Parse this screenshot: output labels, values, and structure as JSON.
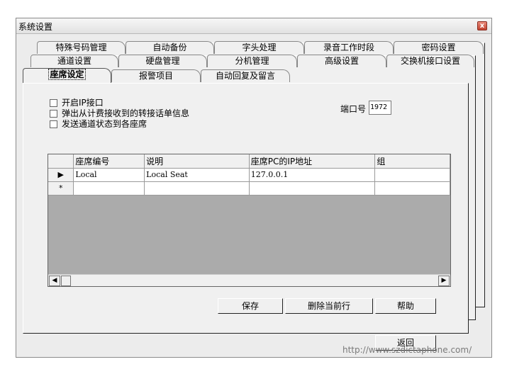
{
  "window": {
    "title": "系统设置",
    "close_glyph": "x"
  },
  "tabs": {
    "row1": [
      "特殊号码管理",
      "自动备份",
      "字头处理",
      "录音工作时段",
      "密码设置"
    ],
    "row2": [
      "通道设置",
      "硬盘管理",
      "分机管理",
      "高级设置",
      "交换机接口设置"
    ],
    "row3": [
      "座席设定",
      "报警项目",
      "自动回复及留言"
    ],
    "active": "座席设定"
  },
  "options": {
    "enable_ip": "开启IP接口",
    "popup_transfer": "弹出从计费接收到的转接话单信息",
    "send_status": "发送通道状态到各座席"
  },
  "port": {
    "label": "端口号",
    "value": "1972"
  },
  "grid": {
    "columns": [
      "座席编号",
      "说明",
      "座席PC的IP地址",
      "组"
    ],
    "rows": [
      {
        "marker": "▶",
        "seat_no": "Local",
        "desc": "Local Seat",
        "ip": "127.0.0.1",
        "group": ""
      },
      {
        "marker": "*",
        "seat_no": "",
        "desc": "",
        "ip": "",
        "group": ""
      }
    ]
  },
  "buttons": {
    "save": "保存",
    "delete_row": "删除当前行",
    "help": "帮助",
    "back": "返回"
  },
  "watermark": "http://www.szdictaphone.com/"
}
